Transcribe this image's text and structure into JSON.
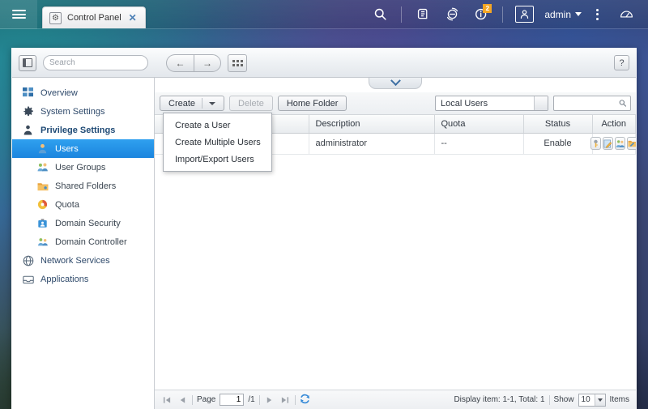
{
  "topbar": {
    "menu_icon": "hamburger-icon",
    "tab": {
      "icon": "gear-icon",
      "title": "Control Panel",
      "close": "✕"
    },
    "icons": [
      {
        "name": "search-icon"
      },
      {
        "name": "resource-monitor-icon"
      },
      {
        "name": "background-task-icon"
      },
      {
        "name": "notification-info-icon",
        "badge": "2"
      },
      {
        "name": "user-account-icon"
      }
    ],
    "user": {
      "label": "admin"
    },
    "more_icon": "kebab-menu-icon",
    "dashboard_icon": "dashboard-speedometer-icon"
  },
  "window": {
    "header": {
      "panel_toggle": "sidebar-toggle-icon",
      "search_placeholder": "Search",
      "search_value": "",
      "back": "←",
      "forward": "→",
      "apps": "apps-grid-icon",
      "help": "?"
    }
  },
  "sidebar": {
    "items": [
      {
        "label": "Overview",
        "icon": "overview-grid-icon",
        "level": "top",
        "active": false
      },
      {
        "label": "System Settings",
        "icon": "gear-icon",
        "level": "top",
        "active": false
      },
      {
        "label": "Privilege Settings",
        "icon": "person-icon",
        "level": "group",
        "active": false
      },
      {
        "label": "Users",
        "icon": "user-icon",
        "level": "child",
        "active": true
      },
      {
        "label": "User Groups",
        "icon": "user-group-icon",
        "level": "child",
        "active": false
      },
      {
        "label": "Shared Folders",
        "icon": "shared-folder-icon",
        "level": "child",
        "active": false
      },
      {
        "label": "Quota",
        "icon": "quota-pie-icon",
        "level": "child",
        "active": false
      },
      {
        "label": "Domain Security",
        "icon": "domain-security-icon",
        "level": "child",
        "active": false
      },
      {
        "label": "Domain Controller",
        "icon": "domain-controller-icon",
        "level": "child",
        "active": false
      },
      {
        "label": "Network Services",
        "icon": "globe-icon",
        "level": "top",
        "active": false
      },
      {
        "label": "Applications",
        "icon": "applications-box-icon",
        "level": "top",
        "active": false
      }
    ]
  },
  "toolbar": {
    "create_label": "Create",
    "delete_label": "Delete",
    "home_folder_label": "Home Folder",
    "filter_value": "Local Users",
    "search_value": "",
    "menu": {
      "open": true,
      "items": [
        "Create a User",
        "Create Multiple Users",
        "Import/Export Users"
      ]
    }
  },
  "table": {
    "columns": [
      "",
      "Description",
      "Quota",
      "Status",
      "Action"
    ],
    "rows": [
      {
        "name": "",
        "description": "administrator",
        "quota": "--",
        "status": "Enable",
        "actions": [
          "change-password-icon",
          "edit-account-icon",
          "edit-user-groups-icon",
          "edit-shared-folder-permission-icon"
        ]
      }
    ]
  },
  "pager": {
    "first": "⏮",
    "prev": "◀",
    "page_label": "Page",
    "page_value": "1",
    "total_pages": "/1",
    "next": "▶",
    "last": "⏭",
    "refresh_icon": "refresh-icon",
    "display_info": "Display item: 1-1, Total: 1",
    "show_label": "Show",
    "show_value": "10",
    "items_label": "Items"
  },
  "colors": {
    "accent": "#1b85de",
    "badge": "#f5a623",
    "link": "#2f86d6"
  }
}
